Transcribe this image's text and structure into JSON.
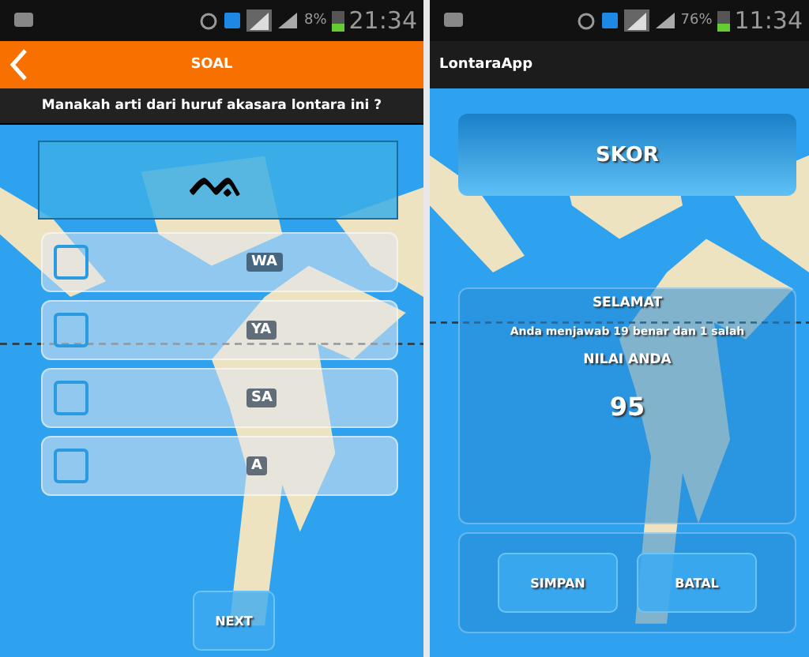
{
  "quiz_screen": {
    "status_bar": {
      "battery": "8%",
      "time": "21:34"
    },
    "app_bar": {
      "title": "SOAL"
    },
    "question": "Manakah arti dari huruf akasara lontara ini ?",
    "glyph": "ᨕ",
    "options": [
      {
        "label": "WA",
        "checked": false
      },
      {
        "label": "YA",
        "checked": false
      },
      {
        "label": "SA",
        "checked": false
      },
      {
        "label": "A",
        "checked": false
      }
    ],
    "next_button": "NEXT"
  },
  "score_screen": {
    "status_bar": {
      "battery": "76%",
      "time": "11:34"
    },
    "app_bar": {
      "title": "LontaraApp"
    },
    "score_title": "SKOR",
    "greeting": "SELAMAT",
    "summary": "Anda menjawab 19 benar dan 1 salah",
    "score_label": "NILAI ANDA",
    "score": "95",
    "buttons": [
      "SIMPAN",
      "BATAL"
    ]
  }
}
